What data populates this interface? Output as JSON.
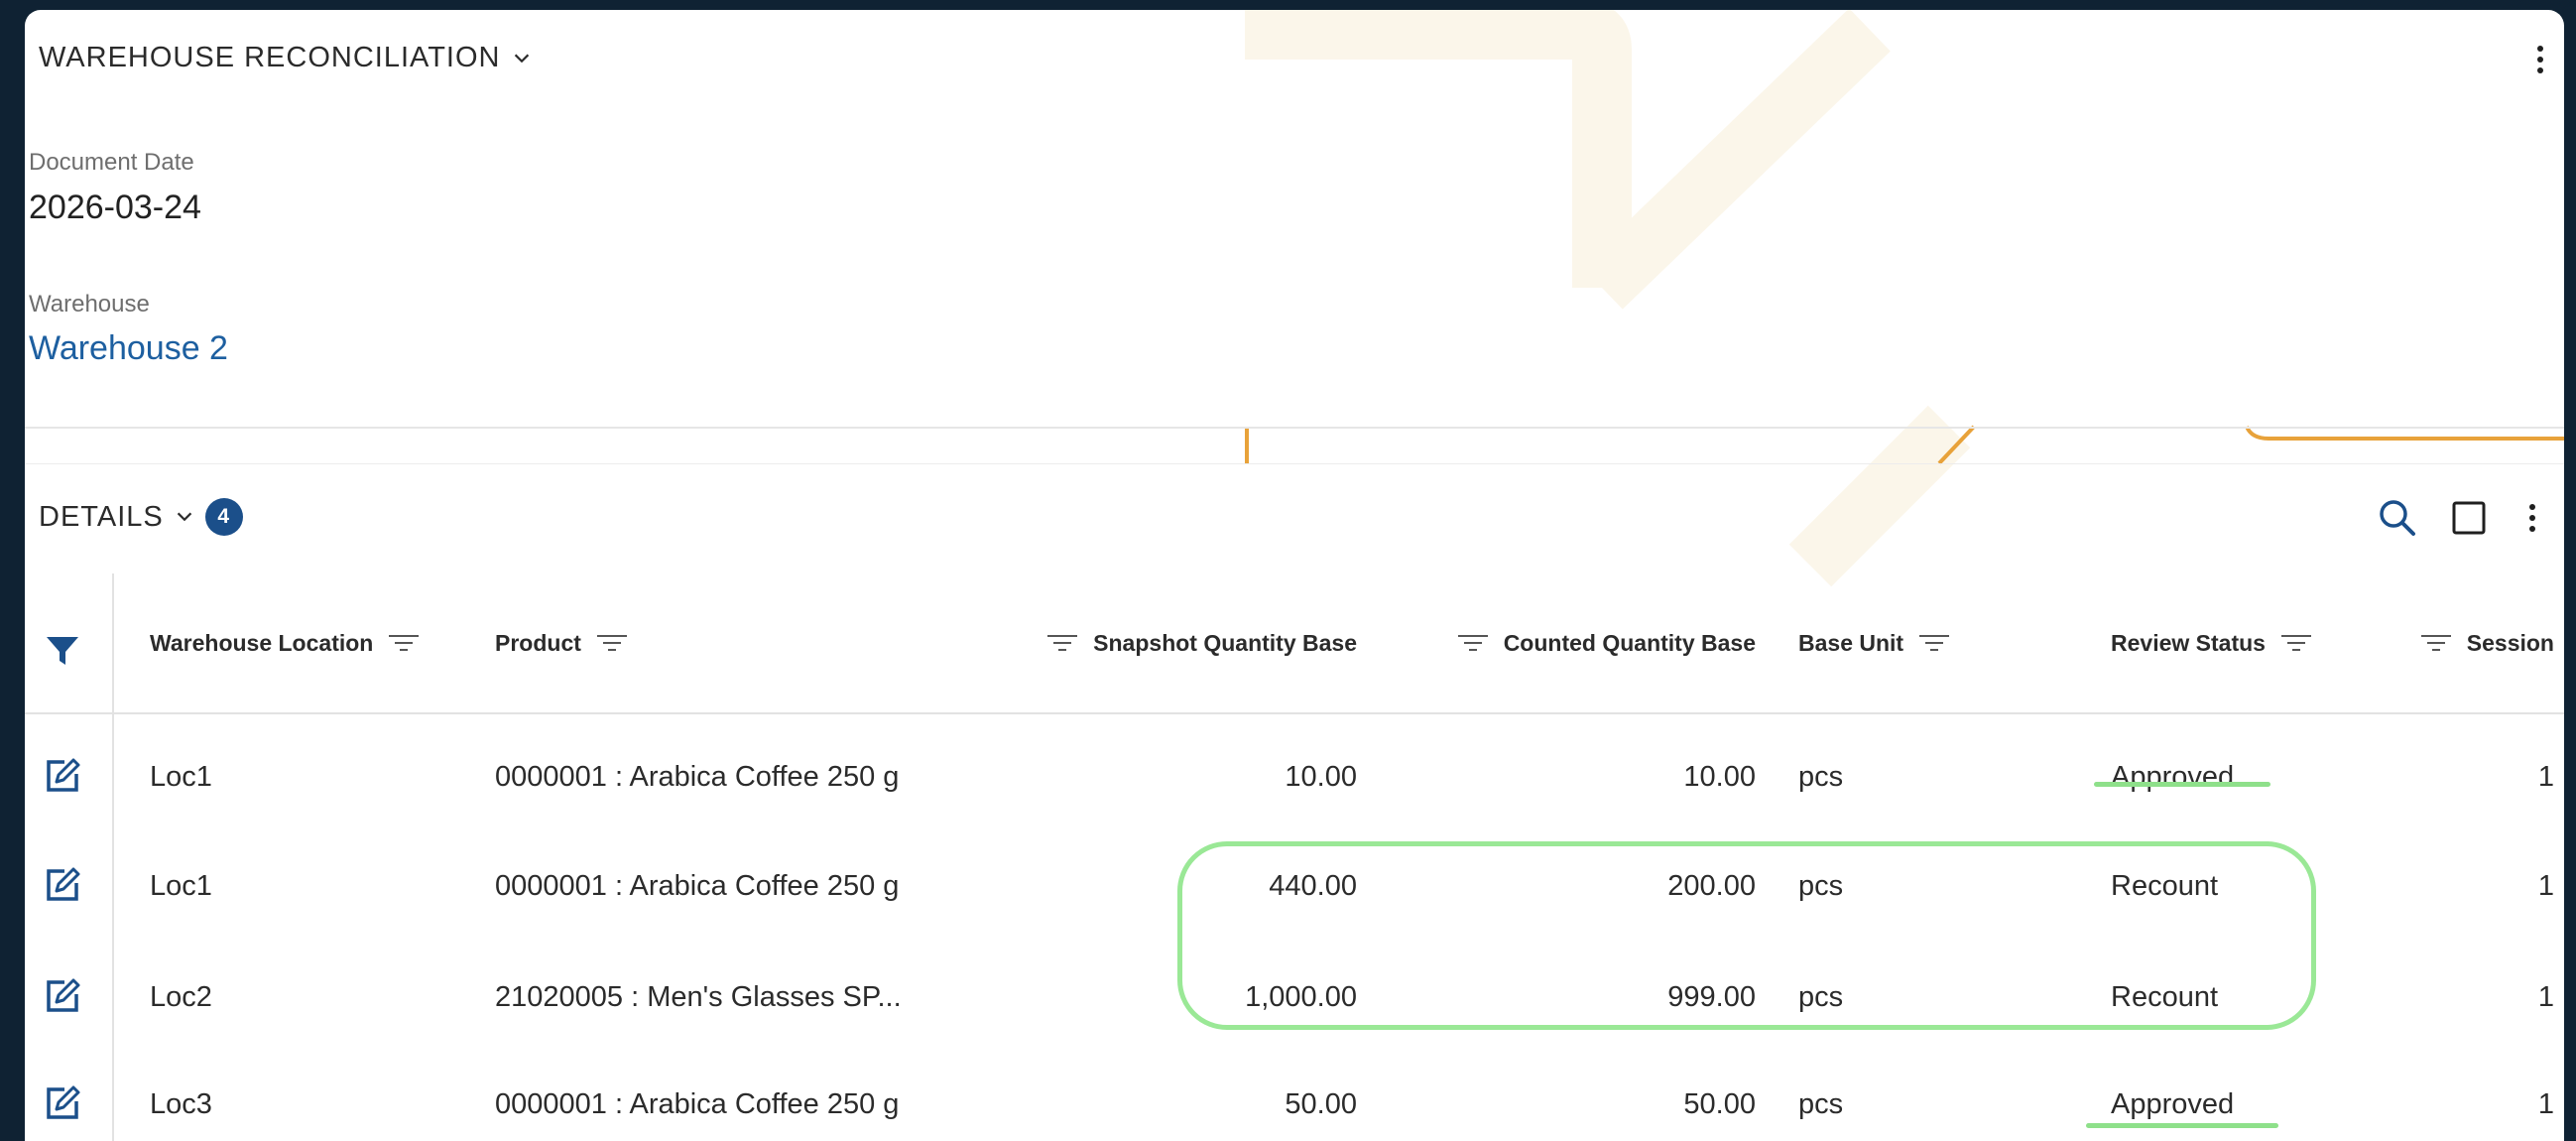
{
  "header": {
    "title": "WAREHOUSE RECONCILIATION"
  },
  "fields": {
    "document_date_label": "Document Date",
    "document_date_value": "2026-03-24",
    "warehouse_label": "Warehouse",
    "warehouse_value": "Warehouse 2"
  },
  "details": {
    "title": "DETAILS",
    "count": "4"
  },
  "table": {
    "columns": {
      "location": "Warehouse Location",
      "product": "Product",
      "snapshot": "Snapshot Quantity Base",
      "counted": "Counted Quantity Base",
      "unit": "Base Unit",
      "status": "Review Status",
      "session": "Session"
    },
    "rows": [
      {
        "location": "Loc1",
        "product": "0000001 : Arabica Coffee 250 g",
        "snapshot": "10.00",
        "counted": "10.00",
        "unit": "pcs",
        "status": "Approved",
        "session": "1"
      },
      {
        "location": "Loc1",
        "product": "0000001 : Arabica Coffee 250 g",
        "snapshot": "440.00",
        "counted": "200.00",
        "unit": "pcs",
        "status": "Recount",
        "session": "1"
      },
      {
        "location": "Loc2",
        "product": "21020005 : Men's Glasses SP...",
        "snapshot": "1,000.00",
        "counted": "999.00",
        "unit": "pcs",
        "status": "Recount",
        "session": "1"
      },
      {
        "location": "Loc3",
        "product": "0000001 : Arabica Coffee 250 g",
        "snapshot": "50.00",
        "counted": "50.00",
        "unit": "pcs",
        "status": "Approved",
        "session": "1"
      }
    ]
  },
  "colors": {
    "accent": "#1b4f8a",
    "link": "#1d5fa0",
    "highlight": "#9ae896"
  }
}
